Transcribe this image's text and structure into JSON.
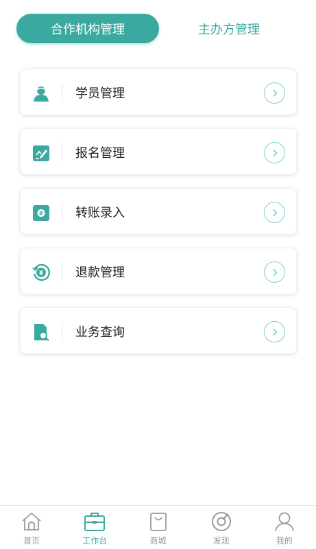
{
  "tabs": {
    "active_label": "合作机构管理",
    "inactive_label": "主办方管理"
  },
  "menu": {
    "items": [
      {
        "label": "学员管理",
        "icon": "student-icon"
      },
      {
        "label": "报名管理",
        "icon": "registration-icon"
      },
      {
        "label": "转账录入",
        "icon": "transfer-icon"
      },
      {
        "label": "退款管理",
        "icon": "refund-icon"
      },
      {
        "label": "业务查询",
        "icon": "business-search-icon"
      }
    ]
  },
  "bottom_nav": {
    "items": [
      {
        "label": "首页",
        "icon": "home-icon",
        "active": false
      },
      {
        "label": "工作台",
        "icon": "briefcase-icon",
        "active": true
      },
      {
        "label": "商城",
        "icon": "shopping-bag-icon",
        "active": false
      },
      {
        "label": "发现",
        "icon": "compass-icon",
        "active": false
      },
      {
        "label": "我的",
        "icon": "person-icon",
        "active": false
      }
    ]
  },
  "colors": {
    "accent": "#3aa99f",
    "accent_light": "#7fcfc7",
    "nav_inactive": "#9a9a9a"
  }
}
